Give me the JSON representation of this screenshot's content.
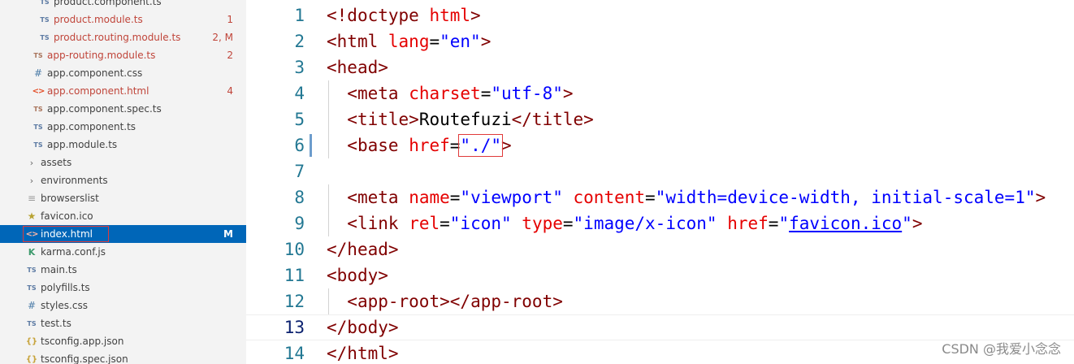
{
  "explorer": {
    "items": [
      {
        "name": "product.component.ts",
        "icon": "TS",
        "badge": ""
      },
      {
        "name": "product.module.ts",
        "icon": "TS",
        "badge": "1"
      },
      {
        "name": "product.routing.module.ts",
        "icon": "TS",
        "badge": "2, M"
      },
      {
        "name": "app-routing.module.ts",
        "icon": "TS",
        "badge": "2"
      },
      {
        "name": "app.component.css",
        "icon": "#",
        "badge": ""
      },
      {
        "name": "app.component.html",
        "icon": "<>",
        "badge": "4"
      },
      {
        "name": "app.component.spec.ts",
        "icon": "TS",
        "badge": ""
      },
      {
        "name": "app.component.ts",
        "icon": "TS",
        "badge": ""
      },
      {
        "name": "app.module.ts",
        "icon": "TS",
        "badge": ""
      },
      {
        "name": "assets",
        "icon": "›",
        "badge": ""
      },
      {
        "name": "environments",
        "icon": "›",
        "badge": ""
      },
      {
        "name": "browserslist",
        "icon": "≡",
        "badge": ""
      },
      {
        "name": "favicon.ico",
        "icon": "★",
        "badge": ""
      },
      {
        "name": "index.html",
        "icon": "<>",
        "badge": "M"
      },
      {
        "name": "karma.conf.js",
        "icon": "K",
        "badge": ""
      },
      {
        "name": "main.ts",
        "icon": "TS",
        "badge": ""
      },
      {
        "name": "polyfills.ts",
        "icon": "TS",
        "badge": ""
      },
      {
        "name": "styles.css",
        "icon": "#",
        "badge": ""
      },
      {
        "name": "test.ts",
        "icon": "TS",
        "badge": ""
      },
      {
        "name": "tsconfig.app.json",
        "icon": "{}",
        "badge": ""
      },
      {
        "name": "tsconfig.spec.json",
        "icon": "{}",
        "badge": ""
      }
    ]
  },
  "editor": {
    "line_numbers": [
      "1",
      "2",
      "3",
      "4",
      "5",
      "6",
      "7",
      "8",
      "9",
      "10",
      "11",
      "12",
      "13",
      "14"
    ],
    "l1": {
      "lt": "<!",
      "tag": "doctype",
      "sp": " ",
      "attr": "html",
      "gt": ">"
    },
    "l2": {
      "lt": "<",
      "tag": "html",
      "sp": " ",
      "attr": "lang",
      "eq": "=",
      "val": "\"en\"",
      "gt": ">"
    },
    "l3": {
      "lt": "<",
      "tag": "head",
      "gt": ">"
    },
    "l4": {
      "lt": "<",
      "tag": "meta",
      "sp": " ",
      "attr": "charset",
      "eq": "=",
      "val": "\"utf-8\"",
      "gt": ">"
    },
    "l5": {
      "lt": "<",
      "tag": "title",
      "gt": ">",
      "text": "Routefuzi",
      "clt": "</",
      "ctag": "title",
      "cgt": ">"
    },
    "l6": {
      "lt": "<",
      "tag": "base",
      "sp": " ",
      "attr": "href",
      "eq": "=",
      "val": "\"./\"",
      "gt": ">"
    },
    "l8": {
      "lt": "<",
      "tag": "meta",
      "sp1": " ",
      "attr1": "name",
      "eq1": "=",
      "val1": "\"viewport\"",
      "sp2": " ",
      "attr2": "content",
      "eq2": "=",
      "val2": "\"width=device-width, initial-scale=1\"",
      "gt": ">"
    },
    "l9": {
      "lt": "<",
      "tag": "link",
      "sp1": " ",
      "attr1": "rel",
      "eq1": "=",
      "val1": "\"icon\"",
      "sp2": " ",
      "attr2": "type",
      "eq2": "=",
      "val2": "\"image/x-icon\"",
      "sp3": " ",
      "attr3": "href",
      "eq3": "=",
      "q1": "\"",
      "link": "favicon.ico",
      "q2": "\"",
      "gt": ">"
    },
    "l10": {
      "lt": "</",
      "tag": "head",
      "gt": ">"
    },
    "l11": {
      "lt": "<",
      "tag": "body",
      "gt": ">"
    },
    "l12": {
      "lt": "<",
      "tag": "app-root",
      "gt": ">",
      "clt": "</",
      "ctag": "app-root",
      "cgt": ">"
    },
    "l13": {
      "lt": "</",
      "tag": "body",
      "gt": ">"
    },
    "l14": {
      "lt": "</",
      "tag": "html",
      "gt": ">"
    }
  },
  "watermark": "CSDN @我爱小念念"
}
